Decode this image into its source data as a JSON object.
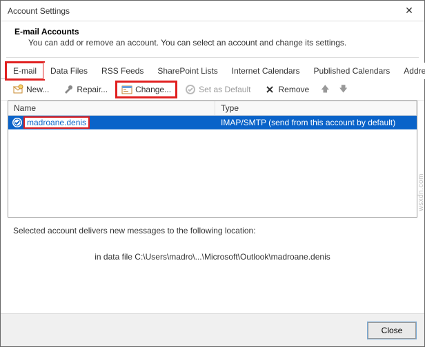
{
  "window": {
    "title": "Account Settings"
  },
  "header": {
    "title": "E-mail Accounts",
    "subtitle": "You can add or remove an account. You can select an account and change its settings."
  },
  "tabs": [
    {
      "label": "E-mail",
      "active": true
    },
    {
      "label": "Data Files"
    },
    {
      "label": "RSS Feeds"
    },
    {
      "label": "SharePoint Lists"
    },
    {
      "label": "Internet Calendars"
    },
    {
      "label": "Published Calendars"
    },
    {
      "label": "Address Books"
    }
  ],
  "toolbar": {
    "new_label": "New...",
    "repair_label": "Repair...",
    "change_label": "Change...",
    "setdefault_label": "Set as Default",
    "remove_label": "Remove"
  },
  "table": {
    "col_name": "Name",
    "col_type": "Type",
    "rows": [
      {
        "name": "madroane.denis",
        "type": "IMAP/SMTP (send from this account by default)"
      }
    ]
  },
  "info": {
    "line1": "Selected account delivers new messages to the following location:",
    "line2": "in data file C:\\Users\\madro\\...\\Microsoft\\Outlook\\madroane.denis"
  },
  "footer": {
    "close_label": "Close"
  },
  "watermark": "wsxdn.com"
}
